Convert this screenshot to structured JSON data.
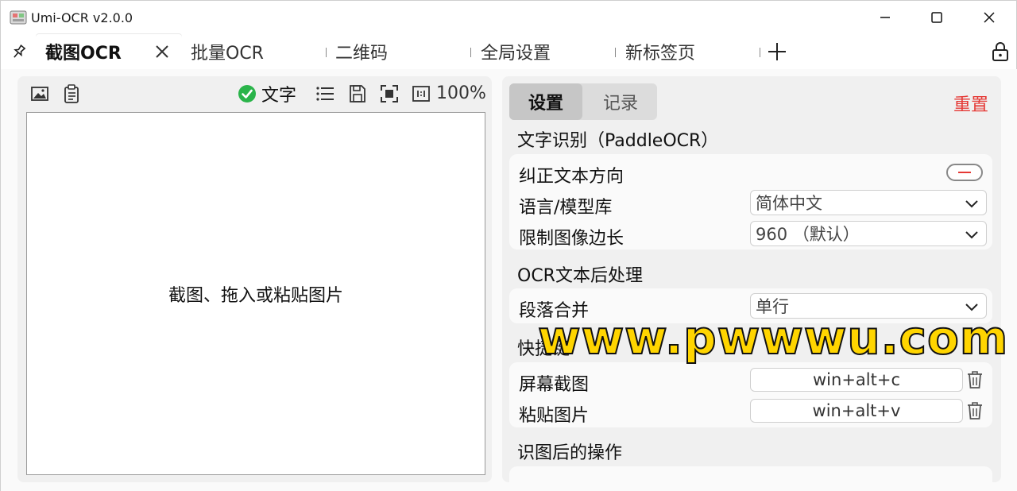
{
  "window": {
    "title": "Umi-OCR v2.0.0"
  },
  "tabs": [
    {
      "label": "截图OCR",
      "active": true
    },
    {
      "label": "批量OCR",
      "active": false
    },
    {
      "label": "二维码",
      "active": false
    },
    {
      "label": "全局设置",
      "active": false
    },
    {
      "label": "新标签页",
      "active": false
    }
  ],
  "left": {
    "text_toggle_label": "文字",
    "zoom": "100%",
    "hint": "截图、拖入或粘贴图片"
  },
  "right": {
    "segments": {
      "settings": "设置",
      "records": "记录"
    },
    "reset": "重置",
    "sections": {
      "ocr": "文字识别（PaddleOCR）",
      "post": "OCR文本后处理",
      "hotkeys": "快捷键",
      "after": "识图后的操作"
    },
    "rows": {
      "correct_direction": "纠正文本方向",
      "language": "语言/模型库",
      "language_value": "简体中文",
      "limit": "限制图像边长",
      "limit_value": "960 （默认）",
      "merge": "段落合并",
      "merge_value": "单行",
      "screenshot": "屏幕截图",
      "screenshot_key": "win+alt+c",
      "paste": "粘贴图片",
      "paste_key": "win+alt+v"
    }
  },
  "watermark": "www.pwwwu.com",
  "colors": {
    "accent_red": "#e53935",
    "check_green": "#2ab44a",
    "watermark_yellow": "#ffd500"
  }
}
